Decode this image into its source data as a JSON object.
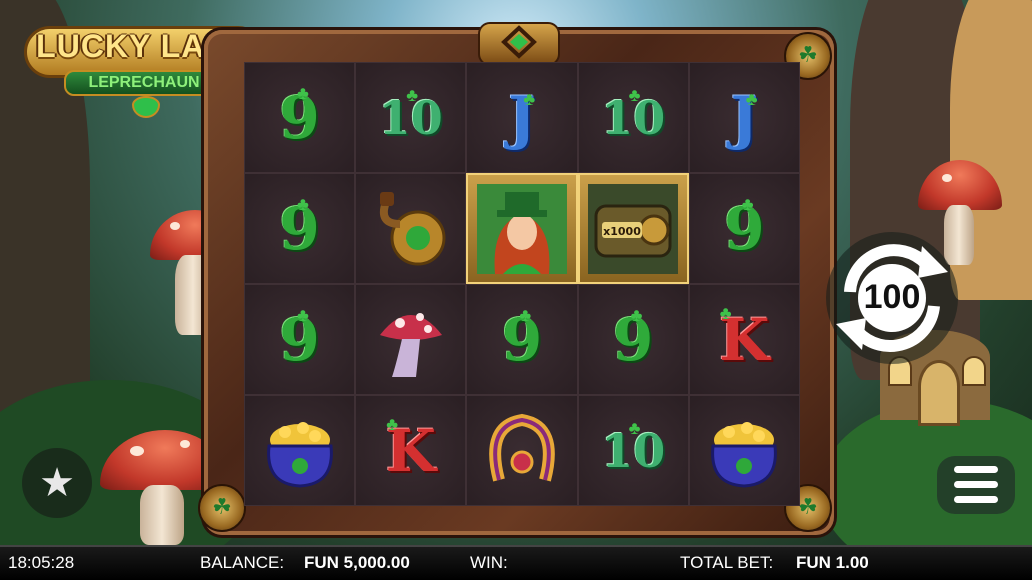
{
  "logo": {
    "title": "LUCKY LADY",
    "subtitle": "LEPRECHAUN"
  },
  "reels": [
    [
      "9",
      "10",
      "J",
      "10",
      "J"
    ],
    [
      "9",
      "pipe-pot",
      "lady",
      "treasure-chest",
      "9"
    ],
    [
      "9",
      "mushroom",
      "9",
      "9",
      "K"
    ],
    [
      "pot-of-gold",
      "K",
      "horseshoe",
      "10",
      "pot-of-gold"
    ]
  ],
  "chest_label": "x1000",
  "controls": {
    "autospin_count": "100"
  },
  "status": {
    "clock": "18:05:28",
    "balance_label": "BALANCE:",
    "balance_value": "FUN 5,000.00",
    "win_label": "WIN:",
    "win_value": "",
    "bet_label": "TOTAL BET:",
    "bet_value": "FUN 1.00"
  },
  "colors": {
    "frame": "#6a3a22",
    "reel_bg": "#2e2226",
    "highlight": "#caa04a"
  }
}
